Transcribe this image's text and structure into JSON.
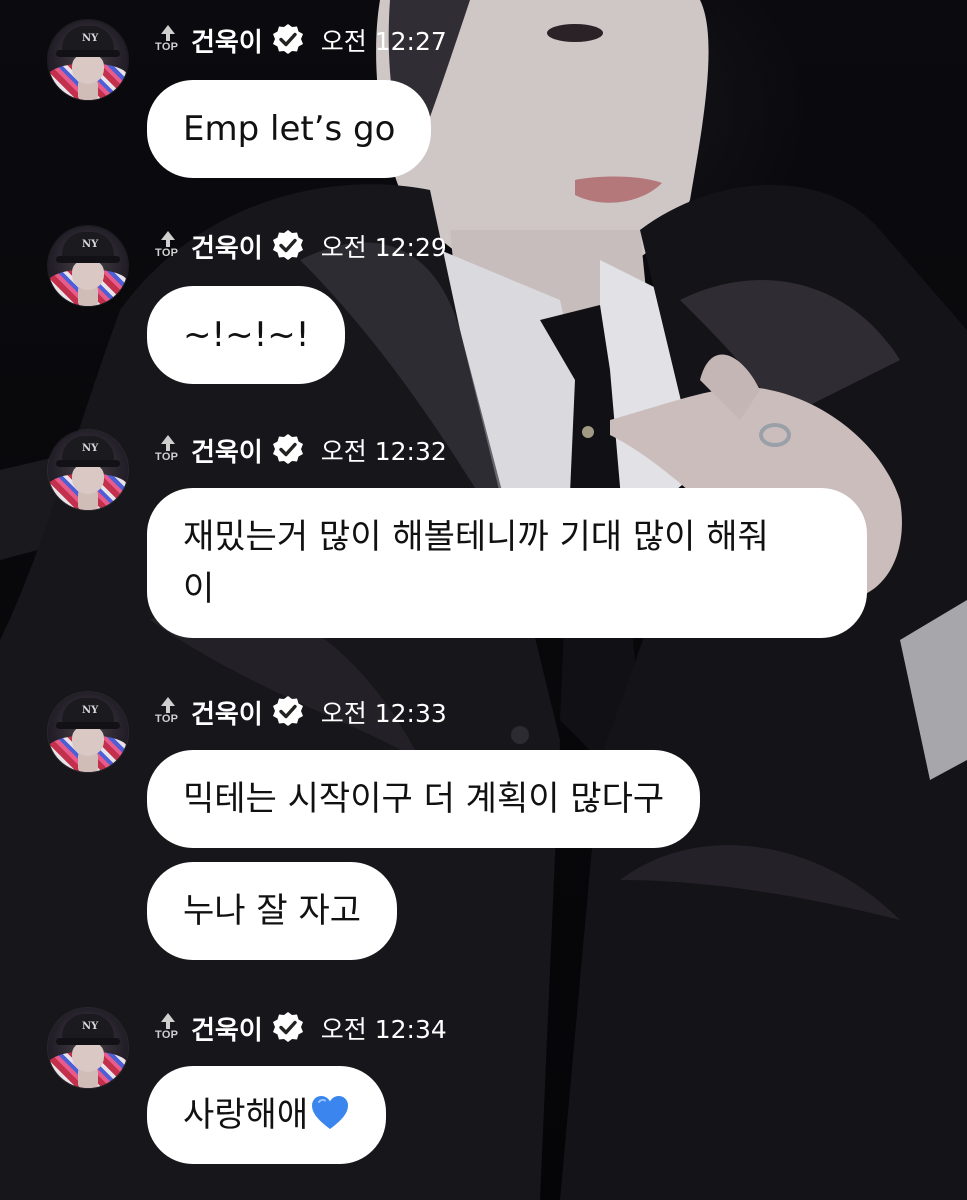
{
  "colors": {
    "background": "#07070a",
    "bubble": "#ffffff",
    "bubble_text": "#111111",
    "header_text": "#ffffff",
    "heart": "#3b86ee"
  },
  "badge_icon": "top-arrow-icon",
  "verified_icon": "verified-badge-icon",
  "messages": [
    {
      "badge": "TOP",
      "sender": "건욱이",
      "time": "오전 12:27",
      "bubbles": [
        {
          "text": "Emp let’s go"
        }
      ]
    },
    {
      "badge": "TOP",
      "sender": "건욱이",
      "time": "오전 12:29",
      "bubbles": [
        {
          "text": "~!~!~!"
        }
      ]
    },
    {
      "badge": "TOP",
      "sender": "건욱이",
      "time": "오전 12:32",
      "bubbles": [
        {
          "text": "재밌는거 많이 해볼테니까 기대 많이 해줘\n이"
        }
      ]
    },
    {
      "badge": "TOP",
      "sender": "건욱이",
      "time": "오전 12:33",
      "bubbles": [
        {
          "text": "믹테는 시작이구 더 계획이 많다구"
        },
        {
          "text": "누나 잘 자고"
        }
      ]
    },
    {
      "badge": "TOP",
      "sender": "건욱이",
      "time": "오전 12:34",
      "bubbles": [
        {
          "text": "사랑해애",
          "emoji": "blue-heart-icon"
        }
      ]
    }
  ]
}
